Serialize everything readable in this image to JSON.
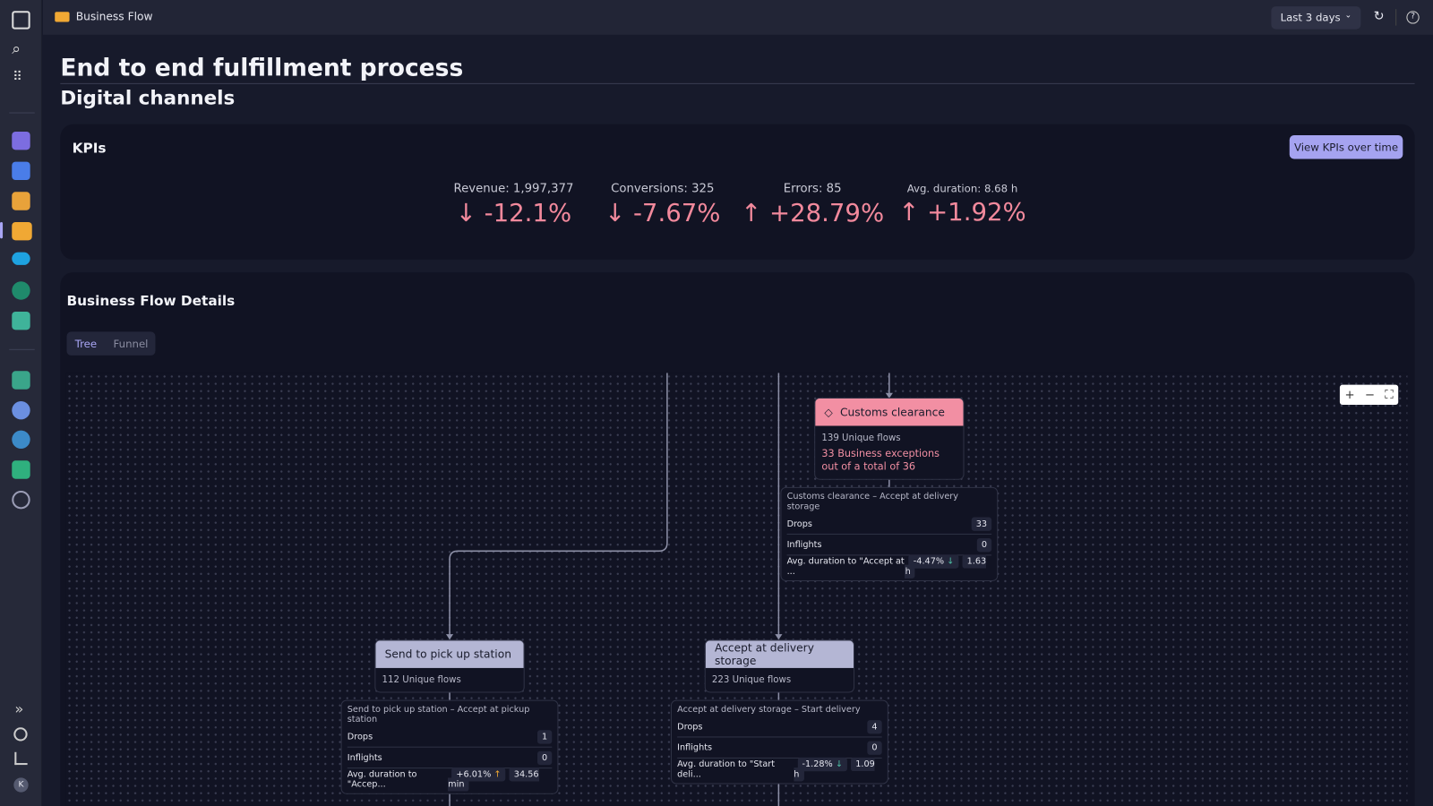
{
  "topbar": {
    "app_title": "Business Flow",
    "timeframe": "Last 3 days"
  },
  "page": {
    "title": "End to end fulfillment process",
    "subtitle": "Digital channels"
  },
  "kpis": {
    "title": "KPIs",
    "button": "View KPIs over time",
    "items": [
      {
        "label": "Revenue: 1,997,377",
        "change": "-12.1%",
        "direction": "down"
      },
      {
        "label": "Conversions: 325",
        "change": "-7.67%",
        "direction": "down"
      },
      {
        "label": "Errors: 85",
        "change": "+28.79%",
        "direction": "up"
      },
      {
        "label": "Avg. duration: 8.68 h",
        "change": "+1.92%",
        "direction": "up"
      }
    ],
    "color": "#f2899c"
  },
  "details": {
    "title": "Business Flow Details",
    "tabs": [
      "Tree",
      "Funnel"
    ],
    "active_tab": "Tree"
  },
  "nodes": [
    {
      "name": "Customs clearance",
      "flows": "139 Unique flows",
      "exception": "33 Business exceptions out of a total of 36",
      "status": "error",
      "color": "#f28fa3"
    },
    {
      "name": "Send to pick up station",
      "flows": "112 Unique flows"
    },
    {
      "name": "Accept at delivery storage",
      "flows": "223 Unique flows"
    }
  ],
  "edges": [
    {
      "title": "Customs clearance – Accept at delivery storage",
      "drops_label": "Drops",
      "drops": "33",
      "inflights_label": "Inflights",
      "inflights": "0",
      "avg_label": "Avg. duration to \"Accept at ...",
      "change": "-4.47%",
      "direction": "down",
      "duration": "1.63 h"
    },
    {
      "title": "Send to pick up station – Accept at pickup station",
      "drops_label": "Drops",
      "drops": "1",
      "inflights_label": "Inflights",
      "inflights": "0",
      "avg_label": "Avg. duration to \"Accep...",
      "change": "+6.01%",
      "direction": "up",
      "duration": "34.56 min"
    },
    {
      "title": "Accept at delivery storage – Start delivery",
      "drops_label": "Drops",
      "drops": "4",
      "inflights_label": "Inflights",
      "inflights": "0",
      "avg_label": "Avg. duration to \"Start deli...",
      "change": "-1.28%",
      "direction": "down",
      "duration": "1.09 h"
    }
  ],
  "sidebar": {
    "user_initial": "K"
  }
}
